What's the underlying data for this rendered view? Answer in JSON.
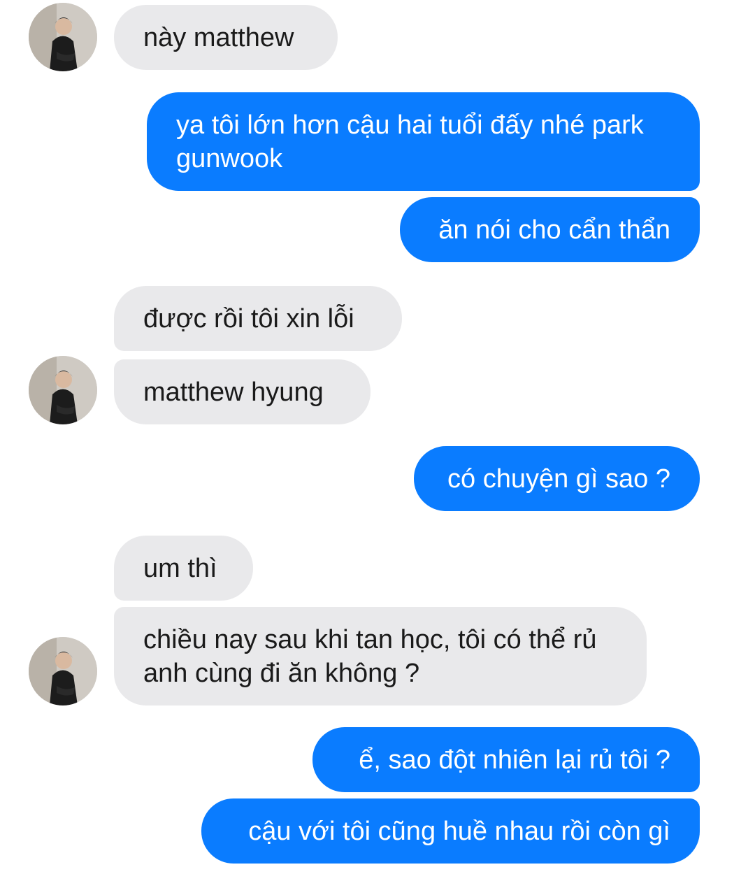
{
  "conversation": {
    "messages": [
      {
        "sender": "other",
        "text": "này matthew"
      },
      {
        "sender": "me",
        "text": "ya tôi lớn hơn cậu hai tuổi đấy nhé park gunwook"
      },
      {
        "sender": "me",
        "text": "ăn nói cho cẩn thẩn"
      },
      {
        "sender": "other",
        "text": "được rồi tôi xin lỗi"
      },
      {
        "sender": "other",
        "text": "matthew hyung"
      },
      {
        "sender": "me",
        "text": "có chuyện gì sao ?"
      },
      {
        "sender": "other",
        "text": "um thì"
      },
      {
        "sender": "other",
        "text": "chiều nay sau khi tan học, tôi có thể rủ anh cùng đi ăn không ?"
      },
      {
        "sender": "me",
        "text": "ể, sao đột nhiên lại rủ tôi ?"
      },
      {
        "sender": "me",
        "text": "cậu với tôi cũng huề nhau rồi còn gì"
      }
    ]
  },
  "colors": {
    "incoming_bubble": "#e9e9eb",
    "outgoing_bubble": "#0a7cff",
    "outgoing_text": "#ffffff",
    "incoming_text": "#1a1a1a"
  },
  "icons": {
    "avatar": "contact-avatar-photo"
  }
}
